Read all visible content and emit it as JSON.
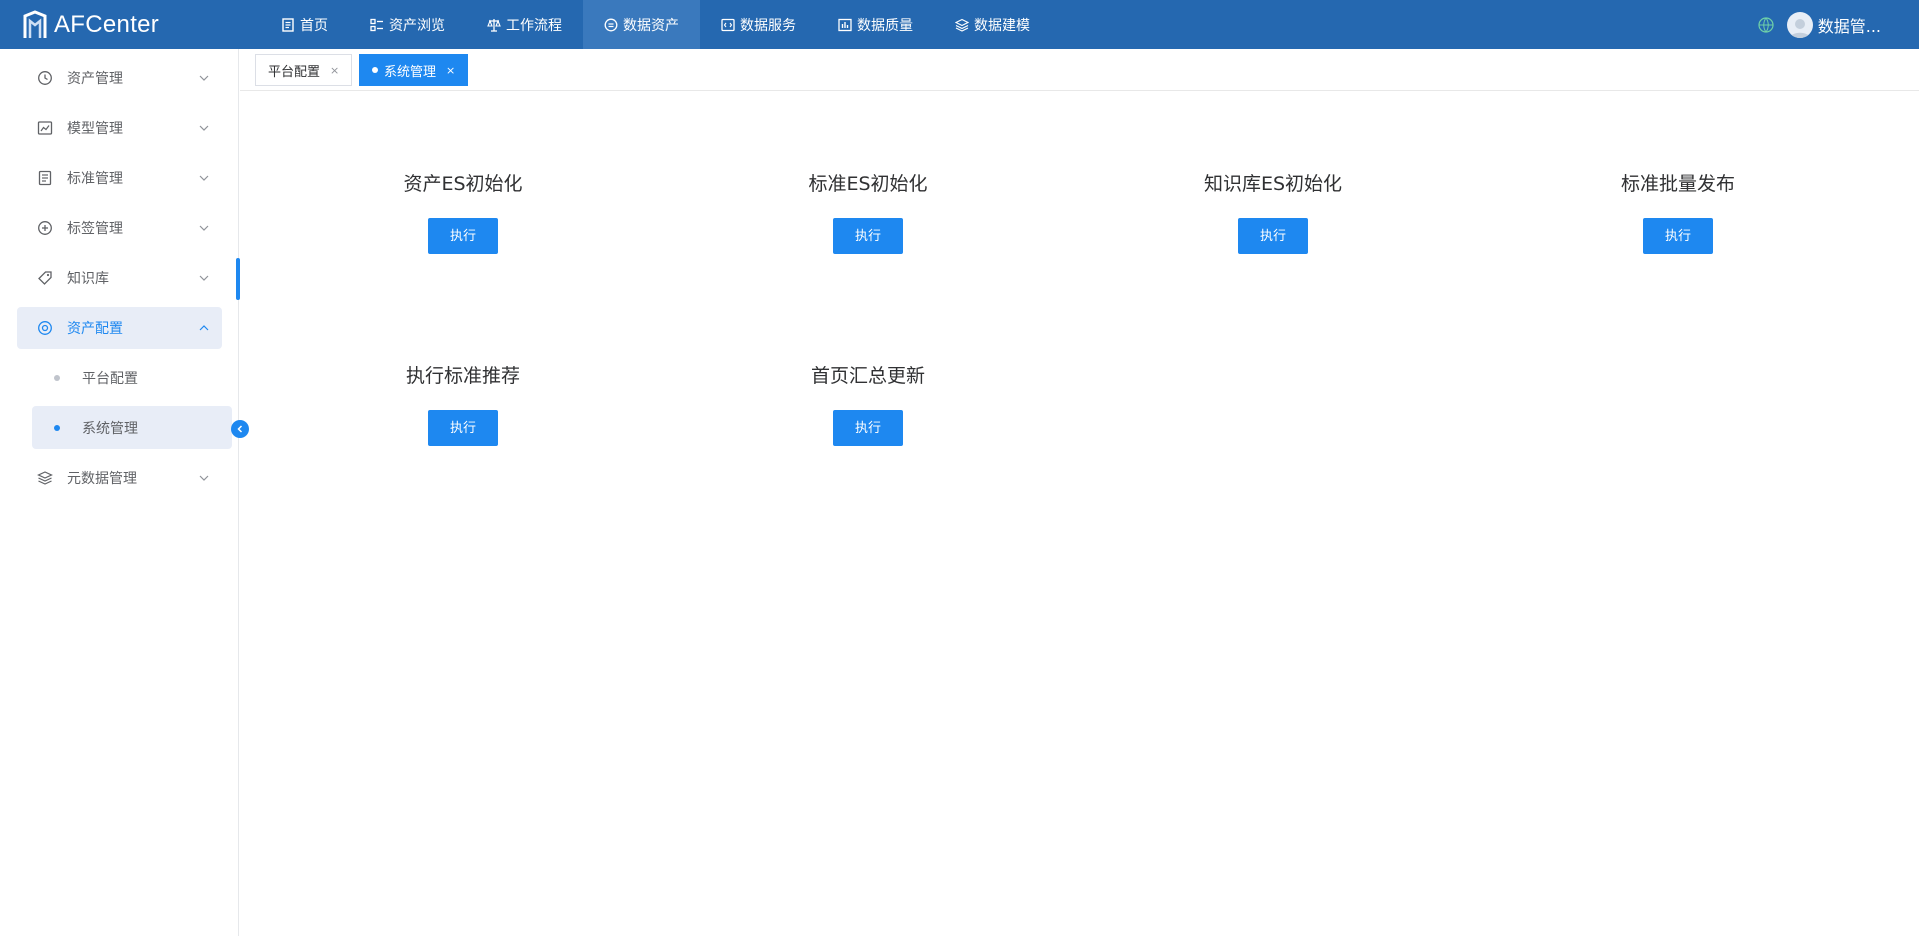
{
  "app": {
    "logo_text": "AFCenter"
  },
  "nav": [
    {
      "label": "首页",
      "icon": "document-icon"
    },
    {
      "label": "资产浏览",
      "icon": "list-icon"
    },
    {
      "label": "工作流程",
      "icon": "scale-icon"
    },
    {
      "label": "数据资产",
      "icon": "database-icon",
      "active": true
    },
    {
      "label": "数据服务",
      "icon": "code-icon"
    },
    {
      "label": "数据质量",
      "icon": "bar-chart-icon"
    },
    {
      "label": "数据建模",
      "icon": "layers-icon"
    }
  ],
  "user": {
    "name": "数据管..."
  },
  "sidebar": {
    "items": [
      {
        "label": "资产管理",
        "icon": "clock-icon"
      },
      {
        "label": "模型管理",
        "icon": "line-chart-icon"
      },
      {
        "label": "标准管理",
        "icon": "document-icon"
      },
      {
        "label": "标签管理",
        "icon": "plus-circle-icon"
      },
      {
        "label": "知识库",
        "icon": "tag-icon"
      },
      {
        "label": "资产配置",
        "icon": "settings-icon",
        "active": true,
        "expanded": true
      },
      {
        "label": "元数据管理",
        "icon": "layers-icon"
      }
    ],
    "subitems": [
      {
        "label": "平台配置"
      },
      {
        "label": "系统管理",
        "active": true
      }
    ]
  },
  "tabs": [
    {
      "label": "平台配置",
      "close": "×"
    },
    {
      "label": "系统管理",
      "close": "×",
      "active": true
    }
  ],
  "tasks": [
    {
      "title": "资产ES初始化",
      "button": "执行"
    },
    {
      "title": "标准ES初始化",
      "button": "执行"
    },
    {
      "title": "知识库ES初始化",
      "button": "执行"
    },
    {
      "title": "标准批量发布",
      "button": "执行"
    },
    {
      "title": "执行标准推荐",
      "button": "执行"
    },
    {
      "title": "首页汇总更新",
      "button": "执行"
    }
  ],
  "colors": {
    "topbar": "#2568b0",
    "accent": "#1e88f0",
    "active_bg": "#e8edf7"
  }
}
